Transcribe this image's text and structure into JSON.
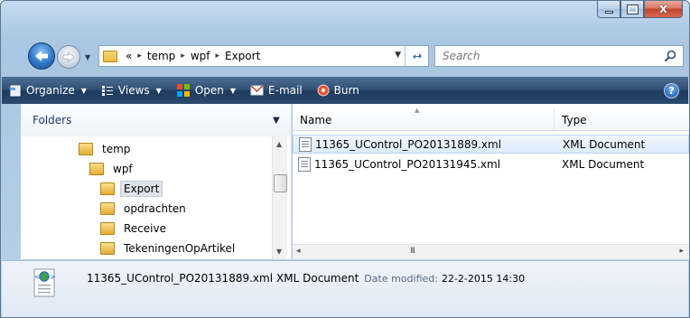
{
  "window": {
    "caption_buttons": {
      "minimize": "",
      "maximize": "",
      "close": "X"
    }
  },
  "address": {
    "overflow": "«",
    "crumbs": [
      "temp",
      "wpf",
      "Export"
    ],
    "separator": "▸"
  },
  "search": {
    "placeholder": "Search"
  },
  "toolbar": {
    "organize": "Organize",
    "views": "Views",
    "open": "Open",
    "email": "E-mail",
    "burn": "Burn",
    "help": "?"
  },
  "nav_pane": {
    "header": "Folders",
    "tree": [
      {
        "label": "temp",
        "indent": 0,
        "selected": false
      },
      {
        "label": "wpf",
        "indent": 1,
        "selected": false
      },
      {
        "label": "Export",
        "indent": 2,
        "selected": true
      },
      {
        "label": "opdrachten",
        "indent": 2,
        "selected": false
      },
      {
        "label": "Receive",
        "indent": 2,
        "selected": false
      },
      {
        "label": "TekeningenOpArtikel",
        "indent": 2,
        "selected": false
      }
    ]
  },
  "file_list": {
    "columns": {
      "name": "Name",
      "type": "Type"
    },
    "rows": [
      {
        "name": "11365_UControl_PO20131889.xml",
        "type": "XML Document",
        "selected": true
      },
      {
        "name": "11365_UControl_PO20131945.xml",
        "type": "XML Document",
        "selected": false
      }
    ],
    "hscroll_grip": "III"
  },
  "details": {
    "file_name": "11365_UControl_PO20131889.xml",
    "file_type": "XML Document",
    "modified_label": "Date modified:",
    "modified_value": "22-2-2015 14:30"
  },
  "colors": {
    "toolbar_bg": "#2e4e72",
    "folders_header_text": "#1e3a73",
    "selection_border": "#b9d4f1"
  }
}
